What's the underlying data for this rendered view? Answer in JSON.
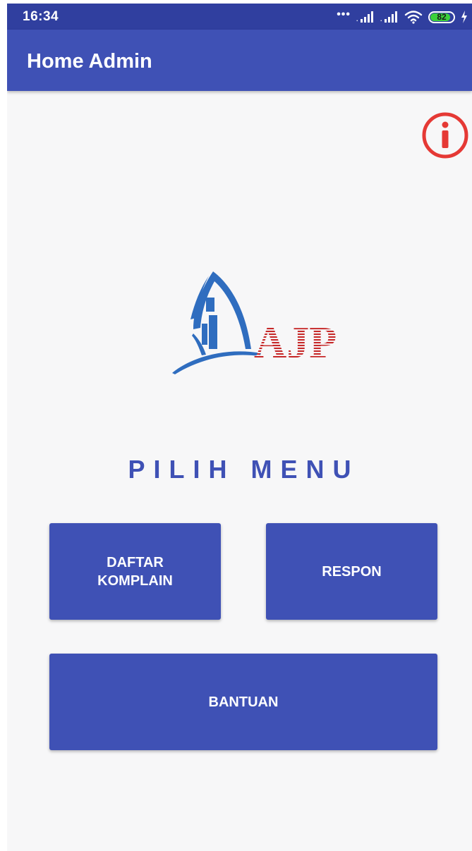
{
  "status_bar": {
    "time": "16:34",
    "signal_dots": "•••",
    "battery_level": "82",
    "battery_fraction": 0.82,
    "icons": [
      "signal-icon",
      "signal-icon",
      "wifi-icon",
      "battery-icon",
      "charging-icon"
    ]
  },
  "app_bar": {
    "title": "Home Admin"
  },
  "info": {
    "icon": "info-icon",
    "color": "#e53935"
  },
  "logo": {
    "text": "AJP"
  },
  "menu": {
    "heading": "PILIH MENU",
    "buttons": {
      "daftar": "DAFTAR\nKOMPLAIN",
      "respon": "RESPON",
      "bantuan": "BANTUAN"
    }
  },
  "colors": {
    "primary": "#3f51b5",
    "primary_dark": "#303f9f",
    "background": "#f7f7f8",
    "logo_blue": "#2f6dbf",
    "logo_red": "#c62828"
  }
}
